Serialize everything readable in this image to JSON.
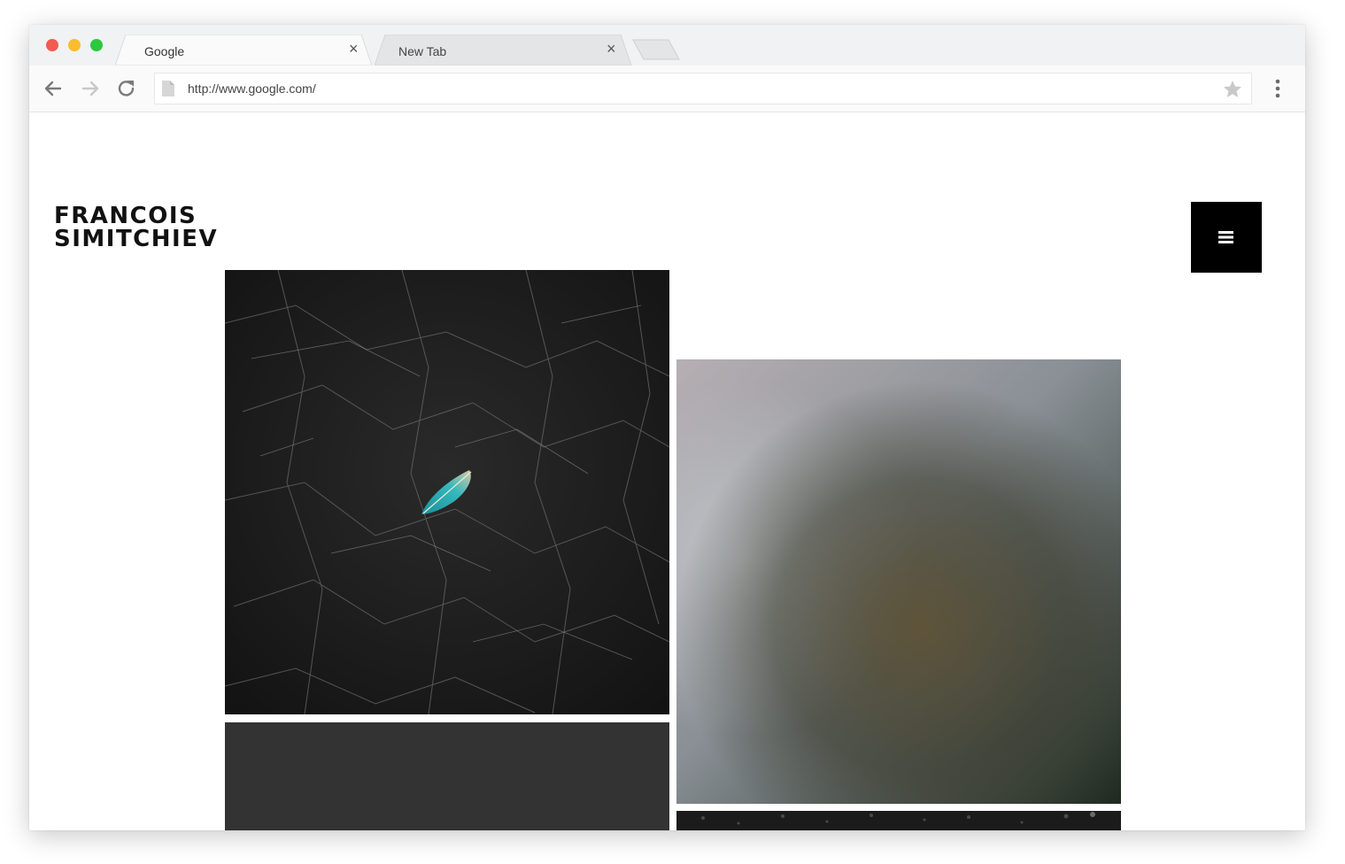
{
  "browser": {
    "tabs": [
      {
        "title": "Google",
        "active": true
      },
      {
        "title": "New Tab",
        "active": false
      }
    ],
    "url": "http://www.google.com/",
    "close_glyph": "×"
  },
  "page": {
    "brand": {
      "line1": "FRANCOIS",
      "line2": "SIMITCHIEV"
    },
    "menu_icon": "hamburger-icon",
    "photos": [
      {
        "name": "feather-on-dark-texture"
      },
      {
        "name": "foggy-blur"
      },
      {
        "name": "dark-gray-panel"
      },
      {
        "name": "dark-gravel"
      }
    ]
  },
  "colors": {
    "traffic_red": "#f25b50",
    "traffic_yellow": "#f9bd2f",
    "traffic_green": "#2bc840",
    "menu_bg": "#000000",
    "feather": "#2aa3a8"
  }
}
